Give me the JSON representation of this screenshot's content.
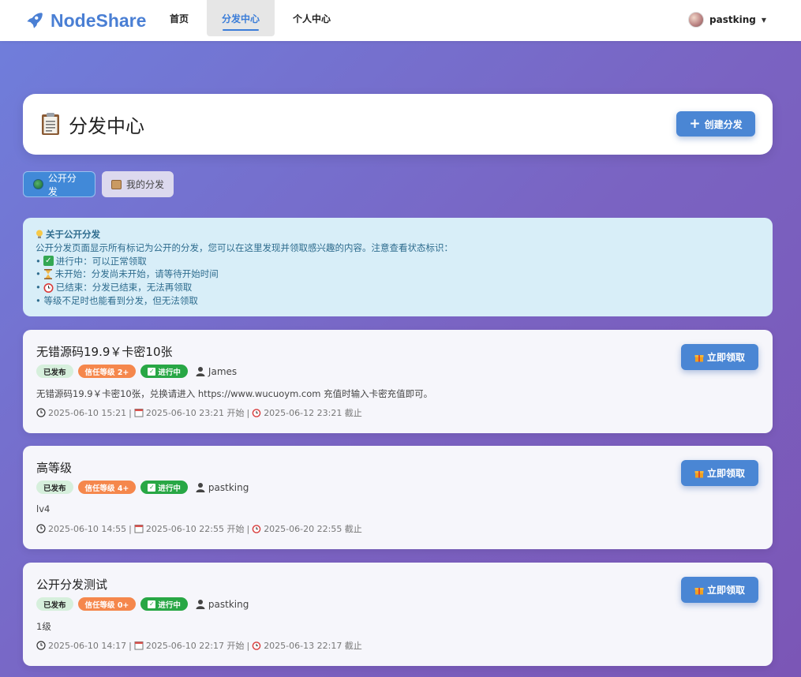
{
  "nav": {
    "brand": "NodeShare",
    "items": [
      {
        "label": "首页"
      },
      {
        "label": "分发中心"
      },
      {
        "label": "个人中心"
      }
    ],
    "user": "pastking"
  },
  "header": {
    "title": "分发中心",
    "create_button": "创建分发"
  },
  "tabs": [
    {
      "label": "公开分发",
      "active": true
    },
    {
      "label": "我的分发",
      "active": false
    }
  ],
  "info": {
    "title": "关于公开分发",
    "intro": "公开分发页面显示所有标记为公开的分发，您可以在这里发现并领取感兴趣的内容。注意查看状态标识：",
    "items": [
      "进行中：可以正常领取",
      "未开始：分发尚未开始，请等待开始时间",
      "已结束：分发已结束，无法再领取",
      "• 等级不足时也能看到分发，但无法领取"
    ],
    "bullet": "•"
  },
  "cards": [
    {
      "title": "无错源码19.9￥卡密10张",
      "badges": {
        "published": "已发布",
        "trust": "信任等级 2+",
        "status": "进行中"
      },
      "owner": "James",
      "desc": "无错源码19.9￥卡密10张，兑换请进入 https://www.wucuoym.com 充值时输入卡密充值即可。",
      "created": "2025-06-10 15:21",
      "start": "2025-06-10 23:21 开始",
      "end": "2025-06-12 23:21 截止",
      "button": "立即领取"
    },
    {
      "title": "高等级",
      "badges": {
        "published": "已发布",
        "trust": "信任等级 4+",
        "status": "进行中"
      },
      "owner": "pastking",
      "desc": "lv4",
      "created": "2025-06-10 14:55",
      "start": "2025-06-10 22:55 开始",
      "end": "2025-06-20 22:55 截止",
      "button": "立即领取"
    },
    {
      "title": "公开分发测试",
      "badges": {
        "published": "已发布",
        "trust": "信任等级 0+",
        "status": "进行中"
      },
      "owner": "pastking",
      "desc": "1级",
      "created": "2025-06-10 14:17",
      "start": "2025-06-10 22:17 开始",
      "end": "2025-06-13 22:17 截止",
      "button": "立即领取"
    }
  ],
  "separator": "|",
  "colors": {
    "brand": "#4a7fd4",
    "primary_button": "#4a86d4",
    "active_tab": "#4189d8",
    "trust_badge": "#f5874c",
    "status_running": "#28a745",
    "info_bg": "#d8eef8"
  }
}
